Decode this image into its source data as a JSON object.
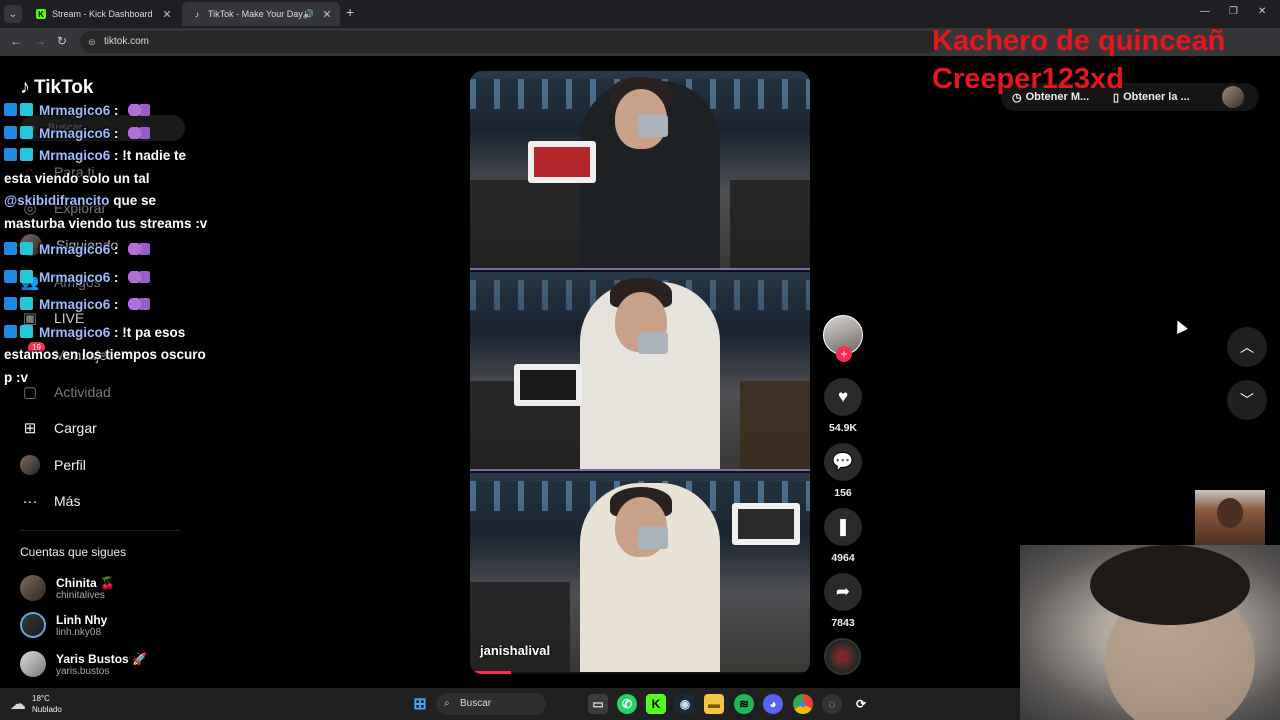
{
  "browser": {
    "tabs": [
      {
        "title": "Stream - Kick Dashboard",
        "favicon": "kick-icon"
      },
      {
        "title": "TikTok - Make Your Day",
        "favicon": "tiktok-icon",
        "active": true
      }
    ],
    "url": "tiktok.com"
  },
  "sidebar": {
    "logo": "TikTok",
    "search_placeholder": "Buscar",
    "items": [
      {
        "label": "Para ti",
        "icon": "home-icon"
      },
      {
        "label": "Explorar",
        "icon": "compass-icon"
      },
      {
        "label": "Siguiendo",
        "icon": "following-icon"
      },
      {
        "label": "Amigos",
        "icon": "friends-icon"
      },
      {
        "label": "LIVE",
        "icon": "live-icon"
      },
      {
        "label": "Mensajes",
        "icon": "messages-icon",
        "badge": "19"
      },
      {
        "label": "Actividad",
        "icon": "activity-icon"
      },
      {
        "label": "Cargar",
        "icon": "upload-icon"
      },
      {
        "label": "Perfil",
        "icon": "profile-avatar"
      },
      {
        "label": "Más",
        "icon": "more-icon"
      }
    ],
    "following_title": "Cuentas que sigues",
    "following": [
      {
        "name": "Chinita",
        "emoji": "🍒",
        "handle": "chinitalives"
      },
      {
        "name": "Linh Nhy",
        "emoji": "",
        "handle": "linh.nky08"
      },
      {
        "name": "Yaris Bustos",
        "emoji": "🚀",
        "handle": "yaris.bustos"
      }
    ]
  },
  "chat": {
    "messages": [
      {
        "user": "Mrmagico6",
        "text": ""
      },
      {
        "user": "Mrmagico6",
        "text": ""
      },
      {
        "user": "Mrmagico6",
        "text": "!t nadie te esta viendo solo un tal",
        "mention": "@skibidifrancito",
        "text2": "que se masturba viendo tus streams :v"
      },
      {
        "user": "Mrmagico6",
        "text": ""
      },
      {
        "user": "Mrmagico6",
        "text": ""
      },
      {
        "user": "Mrmagico6",
        "text": ""
      },
      {
        "user": "Mrmagico6",
        "text": "!t pa esos estamos en los tiempos oscuro p :v"
      }
    ]
  },
  "video": {
    "username": "janishalival",
    "likes": "54.9K",
    "comments": "156",
    "saves": "4964",
    "shares": "7843",
    "progress": 0.12
  },
  "top_right": {
    "overlay_line1": "Kachero de quinceañ",
    "overlay_line2": "Creeper123xd",
    "pill1": "Obtener M...",
    "pill2": "Obtener la ..."
  },
  "taskbar": {
    "temp": "18°C",
    "condition": "Nublado",
    "search": "Buscar"
  }
}
